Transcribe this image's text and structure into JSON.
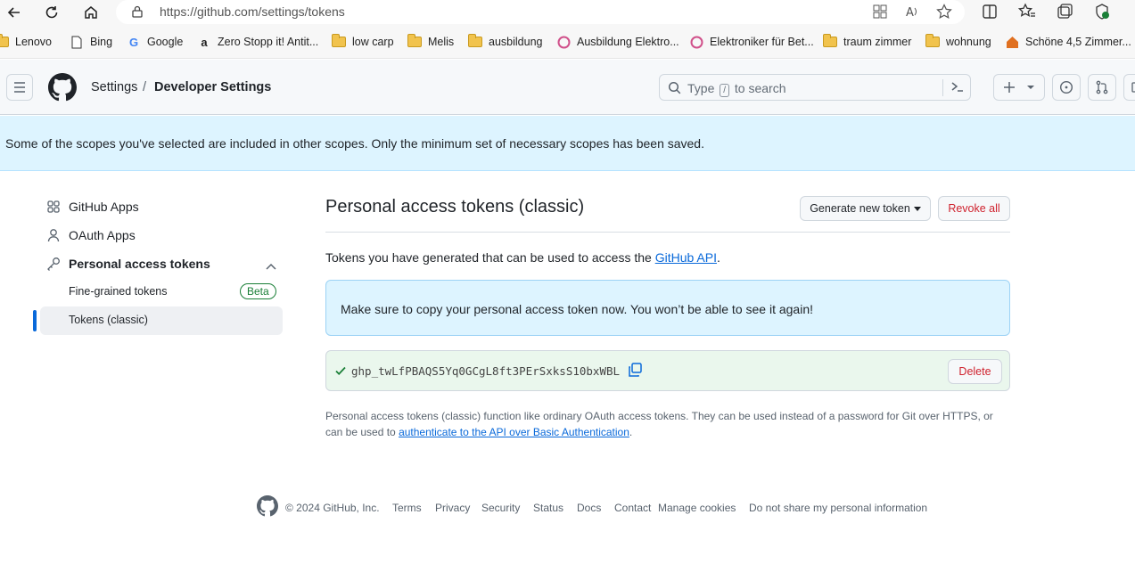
{
  "browser": {
    "url": "https://github.com/settings/tokens",
    "bookmarks": [
      {
        "label": "Lenovo",
        "icon": "folder-icon"
      },
      {
        "label": "Bing",
        "icon": "page-icon"
      },
      {
        "label": "Google",
        "icon": "google-icon"
      },
      {
        "label": "Zero Stopp it! Antit...",
        "icon": "amazon-icon"
      },
      {
        "label": "low carp",
        "icon": "folder-icon"
      },
      {
        "label": "Melis",
        "icon": "folder-icon"
      },
      {
        "label": "ausbildung",
        "icon": "folder-icon"
      },
      {
        "label": "Ausbildung Elektro...",
        "icon": "site-icon"
      },
      {
        "label": "Elektroniker für Bet...",
        "icon": "site-icon"
      },
      {
        "label": "traum zimmer",
        "icon": "folder-icon"
      },
      {
        "label": "wohnung",
        "icon": "folder-icon"
      },
      {
        "label": "Schöne 4,5 Zimmer...",
        "icon": "home-icon"
      }
    ]
  },
  "header": {
    "crumb_settings": "Settings",
    "crumb_sep": "/",
    "crumb_current": "Developer Settings",
    "search_prefix": "Type",
    "search_key": "/",
    "search_suffix": "to search"
  },
  "flash": {
    "message": "Some of the scopes you've selected are included in other scopes. Only the minimum set of necessary scopes has been saved."
  },
  "sidebar": {
    "github_apps": "GitHub Apps",
    "oauth_apps": "OAuth Apps",
    "pat": "Personal access tokens",
    "fine_grained": "Fine-grained tokens",
    "beta": "Beta",
    "classic": "Tokens (classic)"
  },
  "main": {
    "title": "Personal access tokens (classic)",
    "generate_btn": "Generate new token",
    "revoke_btn": "Revoke all",
    "intro_prefix": "Tokens you have generated that can be used to access the ",
    "intro_link": "GitHub API",
    "intro_suffix": ".",
    "notice": "Make sure to copy your personal access token now. You won’t be able to see it again!",
    "token": "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",
    "delete_btn": "Delete",
    "fine_print_prefix": "Personal access tokens (classic) function like ordinary OAuth access tokens. They can be used instead of a password for Git over HTTPS, or can be used to ",
    "fine_print_link": "authenticate to the API over Basic Authentication",
    "fine_print_suffix": "."
  },
  "footer": {
    "copyright": "© 2024 GitHub, Inc.",
    "links": [
      "Terms",
      "Privacy",
      "Security",
      "Status",
      "Docs",
      "Contact",
      "Manage cookies",
      "Do not share my personal information"
    ]
  }
}
